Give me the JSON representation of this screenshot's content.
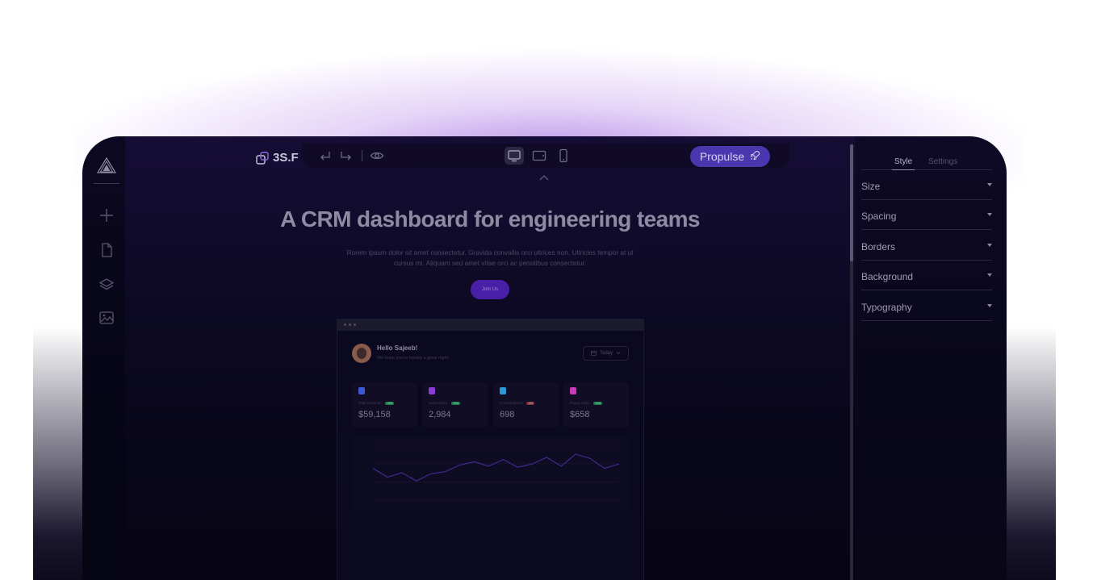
{
  "colors": {
    "accent": "#4a37b0",
    "frame_bg": "#0e0a27",
    "glow": "#a26ede"
  },
  "toolbar": {
    "brand": "3S.F",
    "undo_icon": "undo-icon",
    "redo_icon": "redo-icon",
    "preview_icon": "eye-icon",
    "devices": [
      "desktop-icon",
      "tablet-icon",
      "mobile-icon"
    ],
    "active_device": "desktop",
    "publish_label": "Propulse",
    "publish_icon": "rocket-icon"
  },
  "left_sidebar": {
    "items": [
      "add-icon",
      "page-icon",
      "layers-icon",
      "media-icon"
    ]
  },
  "canvas": {
    "title": "A CRM dashboard for engineering teams",
    "description": "Rorem ipsum dolor sit amet consectetur. Gravida convallis orci ultrices non. Ultricies tempor at ut cursus mi. Aliquam sed amet vitae orci ac penatibus consectetur.",
    "cta_label": "Join Us",
    "preview": {
      "greeting": "Hello Sajeeb!",
      "greeting_sub": "We hope you're having a great night.",
      "date_filter": "Today",
      "stats": [
        {
          "label": "Total Revenue",
          "badge": "+4%",
          "value": "$59,158",
          "icon_color": "#3b5bd8",
          "badge_color": "#1e7a4a"
        },
        {
          "label": "Subscribers",
          "badge": "+9%",
          "value": "2,984",
          "icon_color": "#8a3bd8",
          "badge_color": "#1e7a4a"
        },
        {
          "label": "Conversations",
          "badge": "-3%",
          "value": "698",
          "icon_color": "#2a9bd8",
          "badge_color": "#8a2a3a"
        },
        {
          "label": "Popup sales",
          "badge": "+4%",
          "value": "$658",
          "icon_color": "#c83bb8",
          "badge_color": "#1e7a4a"
        }
      ],
      "chart_values": [
        58,
        42,
        50,
        35,
        48,
        52,
        64,
        70,
        62,
        74,
        60,
        66,
        78,
        62,
        84,
        76,
        58,
        66
      ]
    }
  },
  "right_panel": {
    "tabs": [
      "Style",
      "Settings"
    ],
    "active_tab": "Style",
    "sections": [
      "Size",
      "Spacing",
      "Borders",
      "Background",
      "Typography"
    ]
  },
  "scroll": {
    "fraction_visible": 0.26
  }
}
